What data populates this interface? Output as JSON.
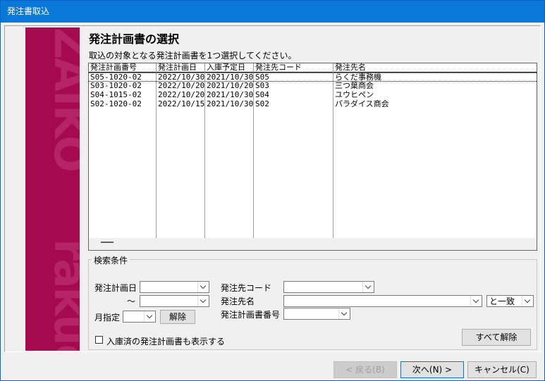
{
  "window": {
    "title": "発注書取込"
  },
  "page": {
    "heading": "発注計画書の選択",
    "instruction": "取込の対象となる発注計画書を1つ選択してください。"
  },
  "sidebar": {
    "brand_top": "ZAIKO",
    "brand_bottom": "rakuda"
  },
  "table": {
    "columns": [
      "発注計画番号",
      "発注計画日",
      "入庫予定日",
      "発注先コード",
      "発注先名"
    ],
    "rows": [
      [
        "S05-1020-02",
        "2022/10/30",
        "2021/10/30",
        "S05",
        "らくだ事務機"
      ],
      [
        "S03-1020-02",
        "2022/10/20",
        "2021/10/20",
        "S03",
        "三つ葉商会"
      ],
      [
        "S04-1015-02",
        "2022/10/20",
        "2021/10/30",
        "S04",
        "ユウヒペン"
      ],
      [
        "S02-1020-02",
        "2022/10/15",
        "2021/10/30",
        "S02",
        "パラダイス商会"
      ]
    ]
  },
  "search": {
    "legend": "検索条件",
    "plan_date_label": "発注計画日",
    "tilde": "～",
    "month_label": "月指定",
    "month_clear": "解除",
    "supplier_code_label": "発注先コード",
    "supplier_name_label": "発注先名",
    "plan_number_label": "発注計画書番号",
    "match_mode": "と一致",
    "show_received_label": "入庫済の発注計画書も表示する",
    "clear_all": "すべて解除"
  },
  "footer": {
    "back": "< 戻る(B)",
    "next": "次へ(N) >",
    "cancel": "キャンセル(C)"
  }
}
